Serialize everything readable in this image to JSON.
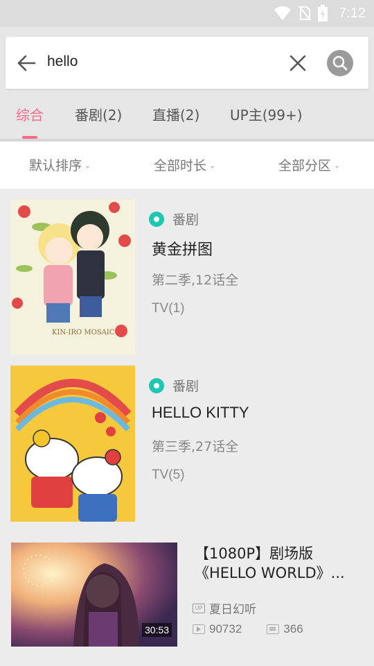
{
  "status_bar": {
    "time": "7:12"
  },
  "search": {
    "query": "hello"
  },
  "tabs": [
    {
      "label": "综合",
      "active": true
    },
    {
      "label": "番剧(2)",
      "active": false
    },
    {
      "label": "直播(2)",
      "active": false
    },
    {
      "label": "UP主(99+)",
      "active": false
    }
  ],
  "filters": [
    {
      "label": "默认排序"
    },
    {
      "label": "全部时长"
    },
    {
      "label": "全部分区"
    }
  ],
  "results": [
    {
      "badge": "番剧",
      "title": "黄金拼图",
      "season": "第二季,12话全",
      "tv": "TV(1)"
    },
    {
      "badge": "番剧",
      "title": "HELLO KITTY",
      "season": "第三季,27话全",
      "tv": "TV(5)"
    }
  ],
  "video": {
    "title_line1": "【1080P】剧场版",
    "title_line2": "《HELLO WORLD》...",
    "uploader": "夏日幻听",
    "views": "90732",
    "danmaku": "366",
    "duration": "30:53",
    "up_badge": "UP"
  },
  "colors": {
    "accent": "#f26b8f",
    "badge": "#1ec6b4"
  }
}
